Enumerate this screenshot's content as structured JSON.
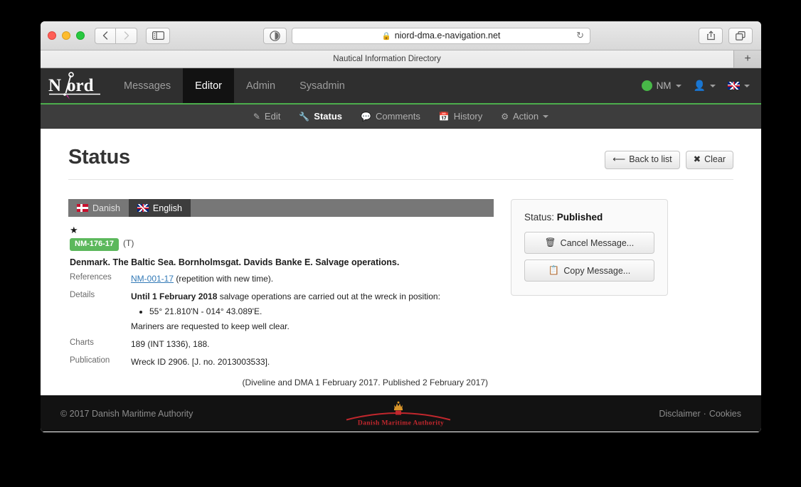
{
  "browser": {
    "url": "niord-dma.e-navigation.net",
    "lock_icon": "lock-icon",
    "reload_icon": "reload-icon",
    "tab_title": "Nautical Information Directory",
    "new_tab_label": "+",
    "back_icon": "chevron-left-icon",
    "forward_icon": "chevron-right-icon",
    "sidebar_icon": "sidebar-toggle-icon",
    "shield_icon": "privacy-shield-icon",
    "share_icon": "share-icon",
    "tabs_overview_icon": "tabs-overview-icon"
  },
  "navbar": {
    "brand": "Niord",
    "items": [
      {
        "label": "Messages",
        "active": false
      },
      {
        "label": "Editor",
        "active": true
      },
      {
        "label": "Admin",
        "active": false
      },
      {
        "label": "Sysadmin",
        "active": false
      }
    ],
    "domain_selector": "NM",
    "status_dot_color": "#48b848",
    "user_icon": "person-icon",
    "language_flag": "uk-flag-icon",
    "accent_color": "#4cae4c"
  },
  "subnav": {
    "items": [
      {
        "label": "Edit",
        "icon": "pencil-icon",
        "active": false
      },
      {
        "label": "Status",
        "icon": "wrench-icon",
        "active": true
      },
      {
        "label": "Comments",
        "icon": "comment-icon",
        "active": false
      },
      {
        "label": "History",
        "icon": "calendar-icon",
        "active": false
      },
      {
        "label": "Action",
        "icon": "gear-icon",
        "active": false,
        "caret": true
      }
    ]
  },
  "page": {
    "title": "Status",
    "back_button": "Back to list",
    "back_icon": "arrow-left-icon",
    "clear_button": "Clear",
    "clear_icon": "x-icon"
  },
  "language_tabs": [
    {
      "label": "Danish",
      "flag": "danish-flag-icon",
      "active": false
    },
    {
      "label": "English",
      "flag": "uk-flag-icon",
      "active": true
    }
  ],
  "message": {
    "star_icon": "star-icon",
    "badge": "NM-176-17",
    "badge_color": "#5cb85c",
    "type": "(T)",
    "title": "Denmark. The Baltic Sea. Bornholmsgat. Davids Banke E. Salvage operations.",
    "references_label": "References",
    "reference_link": "NM-001-17",
    "reference_suffix": " (repetition with new time).",
    "details_label": "Details",
    "details_bold": "Until 1 February 2018",
    "details_text": " salvage operations are carried out at the wreck in position:",
    "details_bullets": [
      "55° 21.810'N - 014° 43.089'E."
    ],
    "details_closing": "Mariners are requested to keep well clear.",
    "charts_label": "Charts",
    "charts_value": "189 (INT 1336), 188.",
    "publication_label": "Publication",
    "publication_value": "Wreck ID 2906. [J. no. 2013003533].",
    "publication_note": "(Diveline and DMA 1 February 2017. Published 2 February 2017)"
  },
  "status_panel": {
    "label": "Status:",
    "value": "Published",
    "cancel_button": "Cancel Message...",
    "cancel_icon": "trash-icon",
    "copy_button": "Copy Message...",
    "copy_icon": "copy-icon"
  },
  "footer": {
    "copyright": "© 2017 Danish Maritime Authority",
    "logo_text": "Danish Maritime Authority",
    "logo_icon": "crown-icon",
    "disclaimer": "Disclaimer",
    "separator": "·",
    "cookies": "Cookies"
  }
}
